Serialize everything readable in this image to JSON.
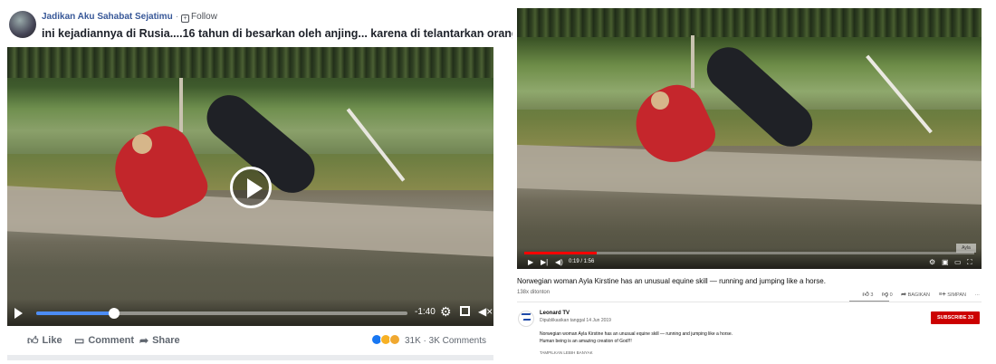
{
  "facebook": {
    "page_name": "Jadikan Aku Sahabat Sejatimu",
    "separator": "·",
    "follow_label": "Follow",
    "post_title": "ini kejadiannya di Rusia....16 tahun di besarkan oleh anjing... karena di telantarkan orang...",
    "more_label": "···",
    "video": {
      "time_remaining": "-1:40",
      "progress_fraction": 0.21
    },
    "actions": {
      "like": "Like",
      "comment": "Comment",
      "share": "Share"
    },
    "reactions_text": "31K · 3K Comments",
    "icons": [
      "page-avatar",
      "follow-icon",
      "play-icon",
      "settings-gear-icon",
      "fullscreen-icon",
      "volume-icon",
      "like-icon",
      "comment-icon",
      "share-icon",
      "reaction-like-icon",
      "reaction-sad-icon",
      "reaction-wow-icon"
    ],
    "colors": {
      "link": "#385898",
      "progress": "#4c8df6",
      "text": "#1d2129",
      "muted": "#606770"
    }
  },
  "youtube": {
    "time": "0:19 / 1:56",
    "progress_fraction": 0.16,
    "watermark": "Ayla",
    "title": "Norwegian woman Ayla Kirstine has an unusual equine skill — running and jumping like a horse.",
    "views": "138x ditonton",
    "likes": "3",
    "dislikes": "0",
    "share_label": "BAGIKAN",
    "save_label": "SIMPAN",
    "more_label": "···",
    "channel": {
      "name": "Leonard TV",
      "published": "Dipublikasikan tanggal 14 Jun 2019",
      "subscribe_label": "SUBSCRIBE 33"
    },
    "description": {
      "line1": "Norwegian woman Ayla Kirstine has an unusual equine skill — running and jumping like a horse.",
      "line2": "Human being is an amazing creation of God!!!"
    },
    "show_more": "TAMPILKAN LEBIH BANYAK",
    "colors": {
      "progress": "#ff0000",
      "subscribe": "#cc0000",
      "muted": "#606060"
    }
  }
}
